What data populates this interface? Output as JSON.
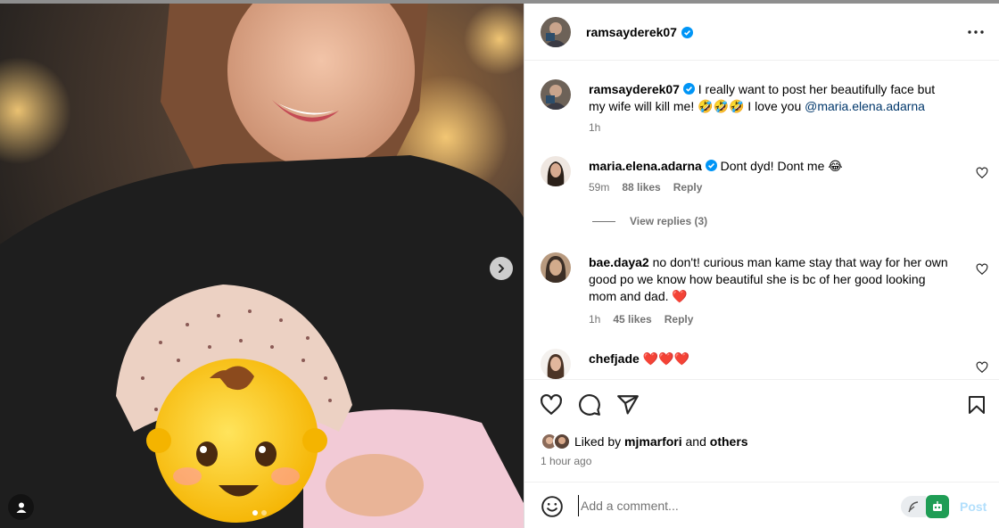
{
  "post": {
    "author": "ramsayderek07",
    "carousel": {
      "total": 2,
      "current": 1
    }
  },
  "comments": [
    {
      "user": "ramsayderek07",
      "verified": true,
      "text_before": "I really want to post her beautifully face but my wife will kill me! 🤣🤣🤣 I love you ",
      "mention": "@maria.elena.adarna",
      "time": "1h"
    },
    {
      "user": "maria.elena.adarna",
      "verified": true,
      "text": "Dont dyd! Dont me 😂",
      "time": "59m",
      "likes": "88 likes",
      "reply": "Reply",
      "view_replies": "View replies (3)"
    },
    {
      "user": "bae.daya2",
      "verified": false,
      "text": "no don't! curious man kame stay that way for her own good po we know how beautiful she is bc of her good looking mom and dad. ❤️",
      "time": "1h",
      "likes": "45 likes",
      "reply": "Reply"
    },
    {
      "user": "chefjade",
      "verified": false,
      "text": "❤️❤️❤️"
    }
  ],
  "likes": {
    "prefix": "Liked by",
    "user": "mjmarfori",
    "conj": "and",
    "others": "others"
  },
  "posted_ago": "1 hour ago",
  "comment_box": {
    "placeholder": "Add a comment...",
    "post_label": "Post"
  },
  "colors": {
    "verified": "#0095f6",
    "heart": "#ff3040",
    "mention": "#00376b",
    "post_disabled": "#b2dffc"
  }
}
